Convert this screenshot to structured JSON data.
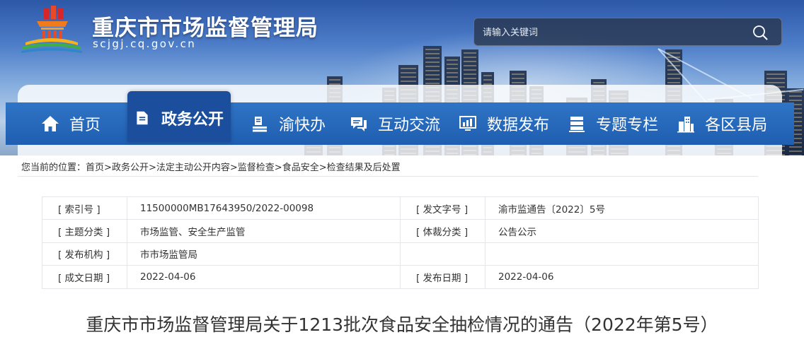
{
  "header": {
    "site_title": "重庆市市场监督管理局",
    "site_domain": "scjgj.cq.gov.cn",
    "search_placeholder": "请输入关键词"
  },
  "nav": {
    "items": [
      {
        "label": "首页",
        "icon": "home-icon",
        "active": false
      },
      {
        "label": "政务公开",
        "icon": "document-icon",
        "active": true
      },
      {
        "label": "渝快办",
        "icon": "stack-icon",
        "active": false
      },
      {
        "label": "互动交流",
        "icon": "chat-icon",
        "active": false
      },
      {
        "label": "数据发布",
        "icon": "chart-icon",
        "active": false
      },
      {
        "label": "专题专栏",
        "icon": "server-icon",
        "active": false
      },
      {
        "label": "各区县局",
        "icon": "buildings-icon",
        "active": false
      }
    ]
  },
  "breadcrumb": {
    "prefix": "您当前的位置：",
    "items": [
      "首页",
      "政务公开",
      "法定主动公开内容",
      "监督检查",
      "食品安全",
      "检查结果及后处置"
    ],
    "separator": ">"
  },
  "meta": {
    "rows": [
      {
        "k1": "[ 索引号 ]",
        "v1": "11500000MB17643950/2022-00098",
        "k2": "[ 发文字号 ]",
        "v2": "渝市监通告〔2022〕5号"
      },
      {
        "k1": "[ 主题分类 ]",
        "v1": "市场监管、安全生产监管",
        "k2": "[ 体裁分类 ]",
        "v2": "公告公示"
      },
      {
        "k1": "[ 发布机构 ]",
        "v1": "市市场监管局",
        "k2": "",
        "v2": ""
      },
      {
        "k1": "[ 成文日期 ]",
        "v1": "2022-04-06",
        "k2": "[ 发布日期 ]",
        "v2": "2022-04-06"
      }
    ]
  },
  "article": {
    "title": "重庆市市场监督管理局关于1213批次食品安全抽检情况的通告（2022年第5号）"
  },
  "colors": {
    "nav_blue": "#2565b8",
    "nav_active": "#1b4f9e",
    "text": "#333333",
    "border": "#e3e6ea"
  }
}
